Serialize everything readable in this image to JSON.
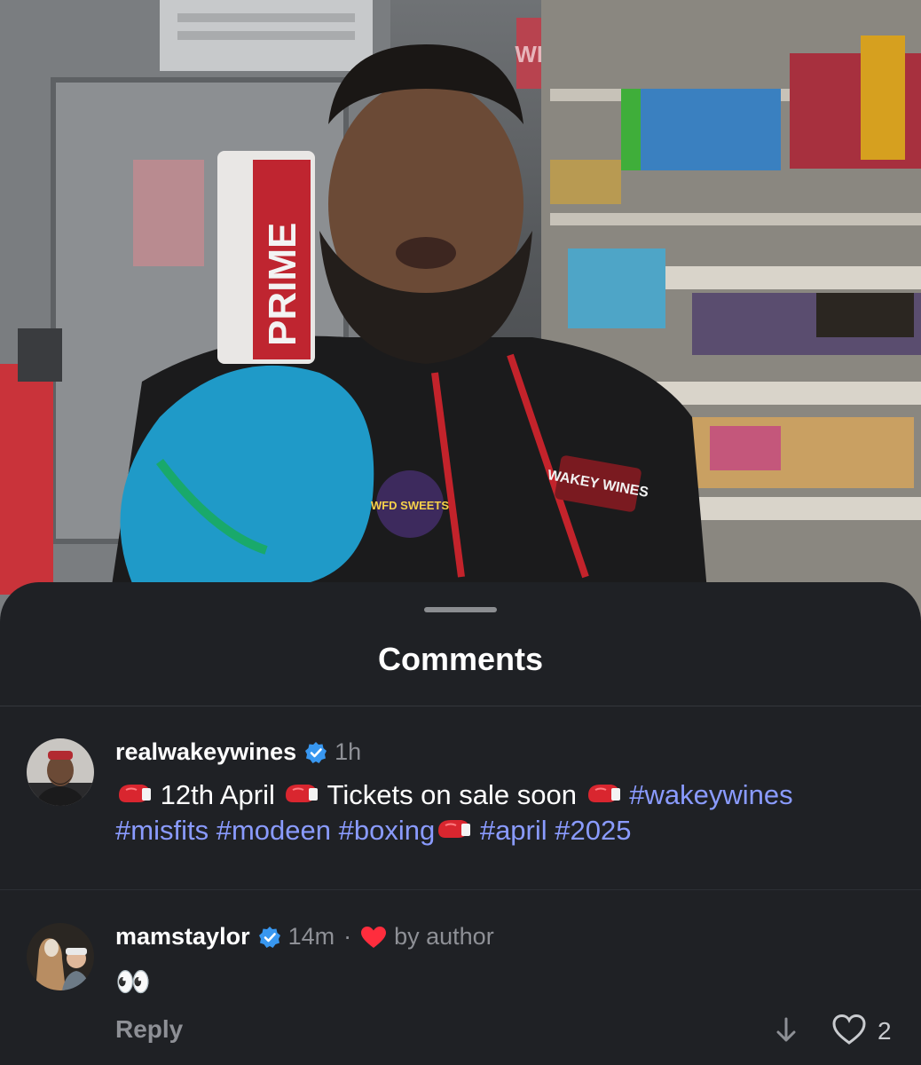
{
  "video": {
    "prime_can_text": "PRIME",
    "store_sign_text": "WINES",
    "hoodie_logo_right": "WAKEY WINES",
    "hoodie_logo_left": "WFD SWEETS"
  },
  "sheet": {
    "title": "Comments"
  },
  "comments": [
    {
      "username": "realwakeywines",
      "verified": true,
      "time": "1h",
      "parts": [
        {
          "type": "icon",
          "name": "boxing-glove-emoji"
        },
        {
          "type": "text",
          "value": " 12th April "
        },
        {
          "type": "icon",
          "name": "boxing-glove-emoji"
        },
        {
          "type": "text",
          "value": " Tickets on sale soon "
        },
        {
          "type": "icon",
          "name": "boxing-glove-emoji"
        },
        {
          "type": "tag",
          "value": " #wakeywines"
        }
      ],
      "line2_tags": [
        "#misfits",
        "#modeen",
        "#boxing"
      ],
      "line2_tail_tags": [
        "#april",
        "#2025"
      ]
    },
    {
      "username": "mamstaylor",
      "verified": true,
      "time": "14m",
      "separator": "·",
      "liked_by_author_label": "by author",
      "emoji_text": "👀",
      "reply_label": "Reply",
      "like_count": "2"
    }
  ],
  "colors": {
    "hashtag": "#8a9bff",
    "verified_badge": "#3897f0",
    "author_heart": "#ff2d3d",
    "sheet_bg": "#1f2125"
  }
}
